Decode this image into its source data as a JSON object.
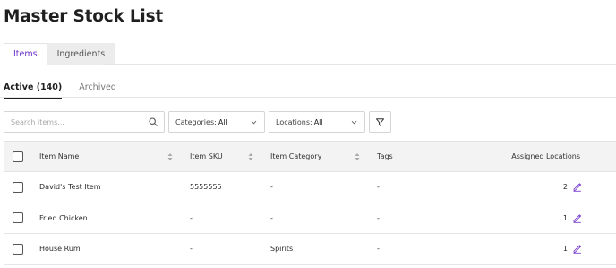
{
  "page": {
    "title": "Master Stock List"
  },
  "main_tabs": [
    {
      "label": "Items",
      "active": true
    },
    {
      "label": "Ingredients",
      "active": false
    }
  ],
  "sub_tabs": [
    {
      "label": "Active (140)",
      "active": true
    },
    {
      "label": "Archived",
      "active": false
    }
  ],
  "filters": {
    "search_placeholder": "Search items...",
    "categories": {
      "label": "Categories:",
      "value": "All"
    },
    "locations": {
      "label": "Locations:",
      "value": "All"
    }
  },
  "table": {
    "headers": {
      "name": "Item Name",
      "sku": "Item SKU",
      "category": "Item Category",
      "tags": "Tags",
      "locations": "Assigned Locations"
    },
    "rows": [
      {
        "name": "David's Test Item",
        "sku": "5555555",
        "category": "-",
        "tags": "-",
        "locations": "2"
      },
      {
        "name": "Fried Chicken",
        "sku": "-",
        "category": "-",
        "tags": "-",
        "locations": "1"
      },
      {
        "name": "House Rum",
        "sku": "-",
        "category": "Spirits",
        "tags": "-",
        "locations": "1"
      }
    ]
  },
  "colors": {
    "accent": "#6b2fc7",
    "header_bg": "#f3f3f3",
    "inactive_tab_bg": "#ececec"
  },
  "icons": [
    "search-icon",
    "chevron-down-icon",
    "filter-icon",
    "sort-icon",
    "edit-pencil-icon"
  ]
}
